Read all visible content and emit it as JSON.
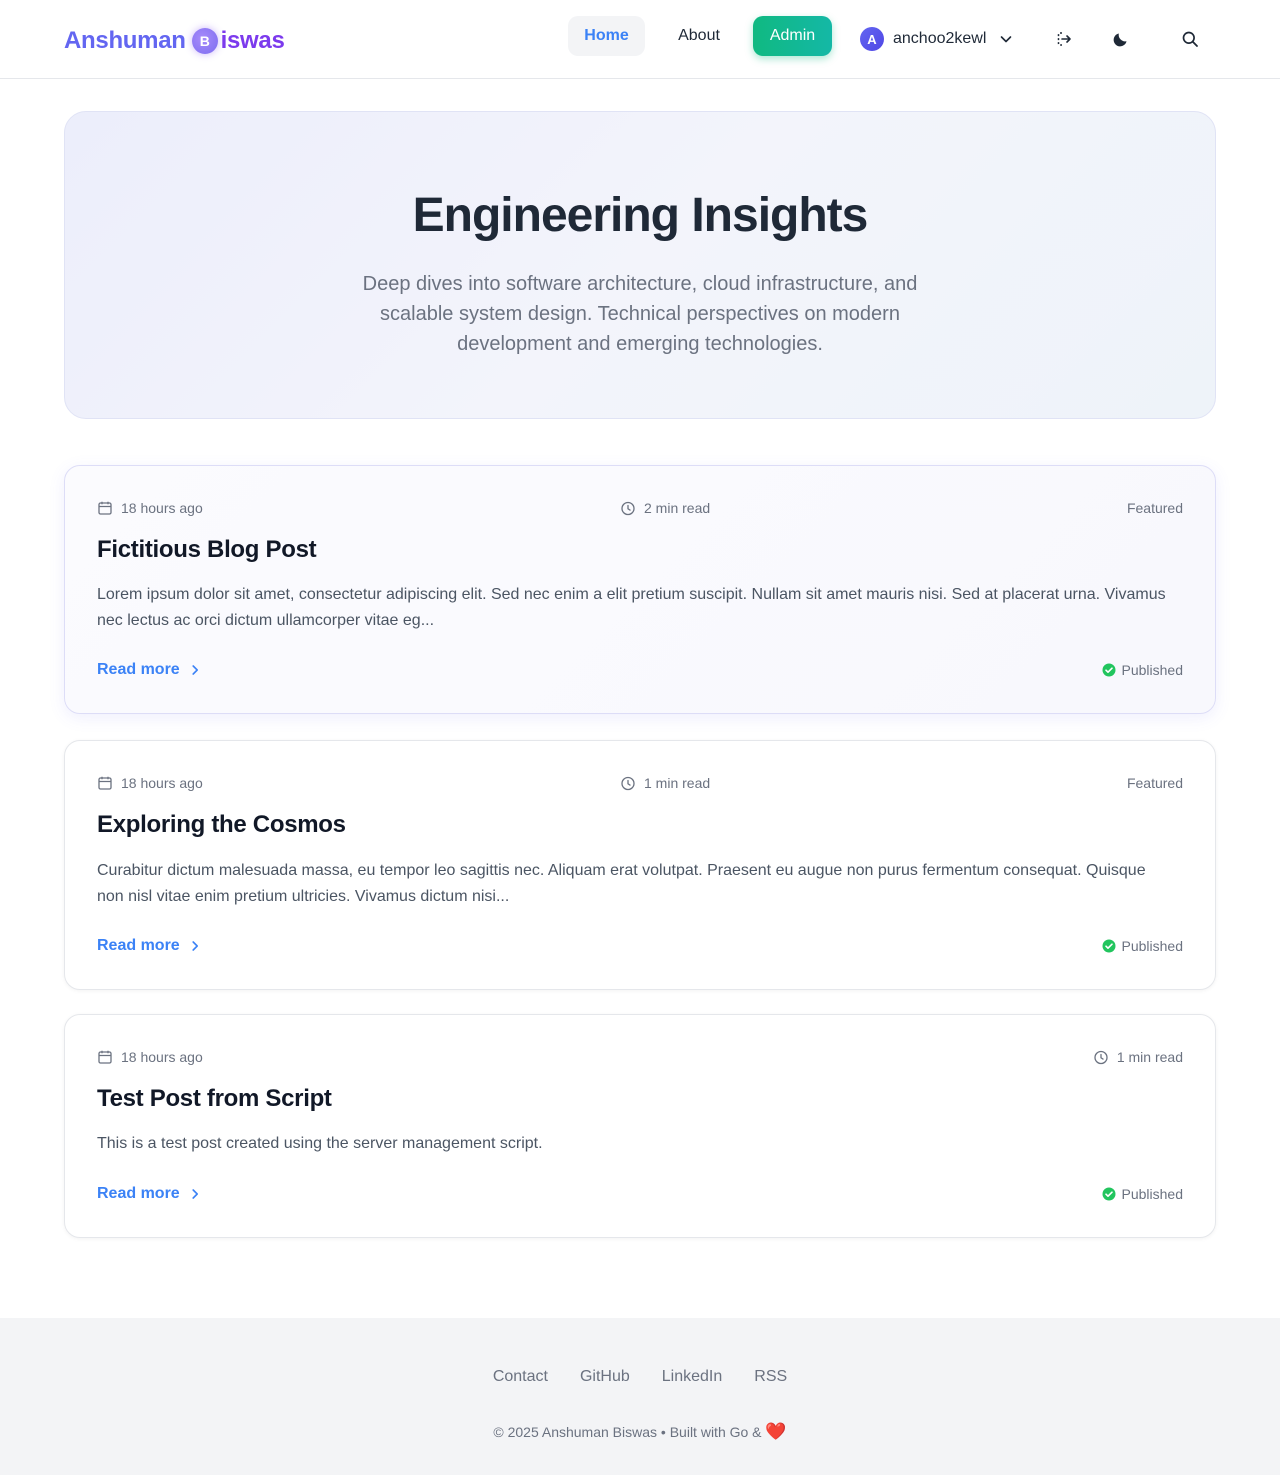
{
  "header": {
    "logo_first": "Anshuman",
    "logo_badge": "B",
    "logo_rest": "iswas",
    "nav": {
      "home": "Home",
      "about": "About",
      "admin": "Admin"
    },
    "user": {
      "avatar_letter": "A",
      "username": "anchoo2kewl"
    },
    "icons": [
      "logout-icon",
      "moon-icon",
      "search-icon"
    ]
  },
  "hero": {
    "title": "Engineering Insights",
    "subtitle": "Deep dives into software architecture, cloud infrastructure, and scalable system design. Technical perspectives on modern development and emerging technologies."
  },
  "posts": [
    {
      "date": "18 hours ago",
      "read_time": "2 min read",
      "tag": "Featured",
      "title": "Fictitious Blog Post",
      "excerpt": "Lorem ipsum dolor sit amet, consectetur adipiscing elit. Sed nec enim a elit pretium suscipit. Nullam sit amet mauris nisi. Sed at placerat urna. Vivamus nec lectus ac orci dictum ullamcorper vitae eg...",
      "read_more": "Read more",
      "status": "Published"
    },
    {
      "date": "18 hours ago",
      "read_time": "1 min read",
      "tag": "Featured",
      "title": "Exploring the Cosmos",
      "excerpt": "Curabitur dictum malesuada massa, eu tempor leo sagittis nec. Aliquam erat volutpat. Praesent eu augue non purus fermentum consequat. Quisque non nisl vitae enim pretium ultricies. Vivamus dictum nisi...",
      "read_more": "Read more",
      "status": "Published"
    },
    {
      "date": "18 hours ago",
      "read_time": "1 min read",
      "title": "Test Post from Script",
      "excerpt": "This is a test post created using the server management script.",
      "read_more": "Read more",
      "status": "Published"
    }
  ],
  "footer": {
    "links": [
      "Contact",
      "GitHub",
      "LinkedIn",
      "RSS"
    ],
    "copyright": "© 2025 Anshuman Biswas • Built with Go &",
    "heart": "❤️"
  },
  "colors": {
    "accent": "#3b82f6",
    "brand": "#6366f1",
    "admin": "#10b981",
    "published": "#22c55e"
  }
}
